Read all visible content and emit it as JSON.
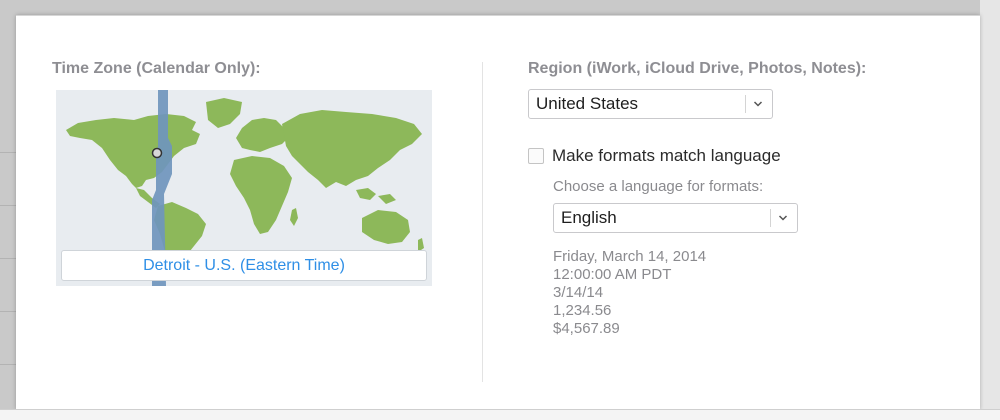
{
  "left_column": {
    "title": "Time Zone (Calendar Only):",
    "timezone_value": "Detroit - U.S. (Eastern Time)"
  },
  "right_column": {
    "region_title": "Region (iWork, iCloud Drive, Photos, Notes):",
    "region_select_value": "United States",
    "checkbox_label": "Make formats match language",
    "checkbox_checked": false,
    "language_hint": "Choose a language for formats:",
    "language_select_value": "English",
    "format_examples": [
      "Friday, March 14, 2014",
      "12:00:00 AM PDT",
      "3/14/14",
      "1,234.56",
      "$4,567.89"
    ]
  },
  "colors": {
    "land": "#8db85a",
    "timezone_band": "#6f95bd",
    "map_background": "#e8ecf0",
    "link_blue": "#2f8fe6"
  },
  "icons": {
    "select_arrow": "chevron-down-icon",
    "map_marker": "location-pin-icon"
  }
}
